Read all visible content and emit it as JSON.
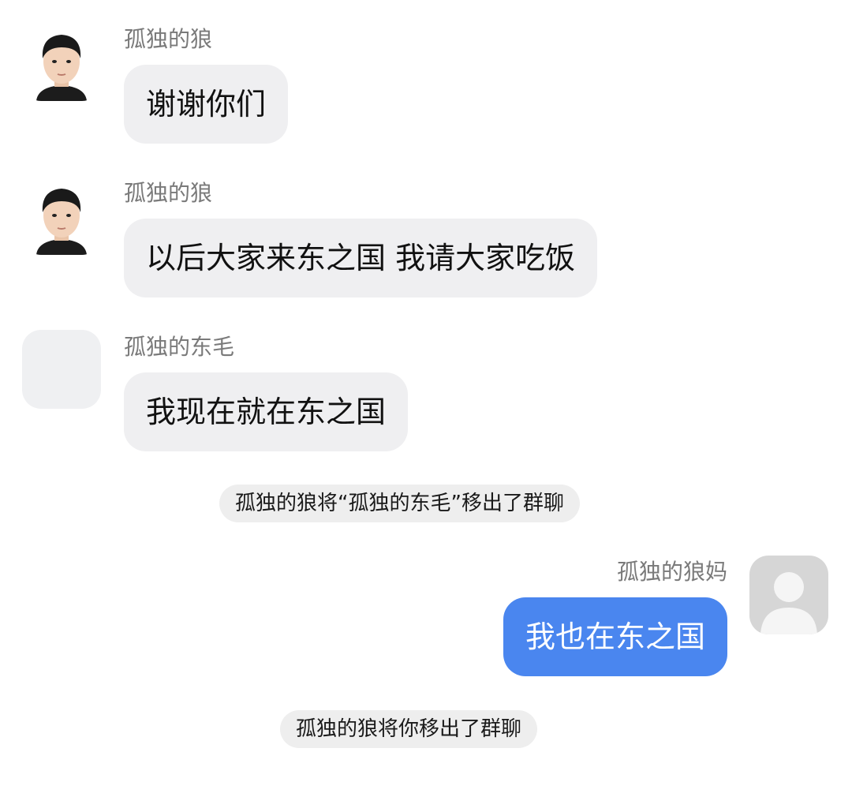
{
  "messages": [
    {
      "sender": "孤独的狼",
      "text": "谢谢你们",
      "avatar_icon": "boy-portrait-avatar"
    },
    {
      "sender": "孤独的狼",
      "text": "以后大家来东之国 我请大家吃饭",
      "avatar_icon": "boy-portrait-avatar"
    },
    {
      "sender": "孤独的东毛",
      "text": "我现在就在东之国",
      "avatar_icon": "blank-avatar"
    }
  ],
  "system_notices": [
    "孤独的狼将“孤独的东毛”移出了群聊",
    "孤独的狼将你移出了群聊"
  ],
  "self_message": {
    "sender": "孤独的狼妈",
    "text": "我也在东之国",
    "avatar_icon": "default-user-avatar"
  },
  "colors": {
    "incoming_bubble": "#efeff1",
    "outgoing_bubble": "#4a86ef",
    "sender_text": "#7a7a7a",
    "system_bubble": "#eeeeee"
  }
}
